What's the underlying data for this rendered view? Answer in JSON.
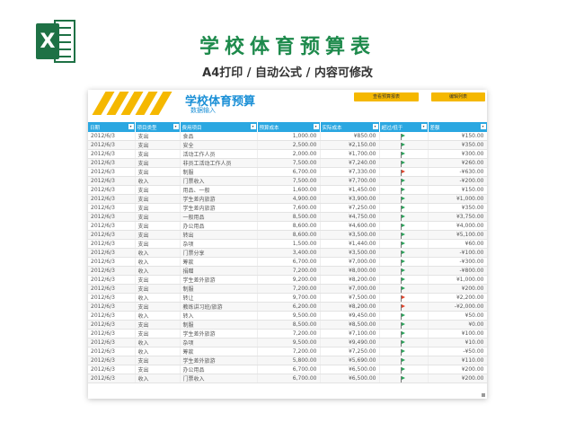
{
  "banner": {
    "title": "学校体育预算表",
    "subtitle": "A4打印 / 自动公式 / 内容可修改",
    "logo_icon": "excel-logo-icon",
    "logo_letter": "X"
  },
  "sheet": {
    "title": "学校体育预算",
    "subtitle": "数据输入",
    "buttons": [
      "查看预算报表",
      "编辑列表"
    ],
    "columns": [
      "日期",
      "项目类型",
      "费用项目",
      "预算成本",
      "实际成本",
      "超过/低于",
      "差额"
    ],
    "rows": [
      [
        "2012/6/3",
        "支出",
        "食品",
        "1,000.00",
        "¥850.00",
        "green",
        "¥150.00"
      ],
      [
        "2012/6/3",
        "支出",
        "安全",
        "2,500.00",
        "¥2,150.00",
        "green",
        "¥350.00"
      ],
      [
        "2012/6/3",
        "支出",
        "活动工作人员",
        "2,000.00",
        "¥1,700.00",
        "green",
        "¥300.00"
      ],
      [
        "2012/6/3",
        "支出",
        "非员工活动工作人员",
        "7,500.00",
        "¥7,240.00",
        "green",
        "¥260.00"
      ],
      [
        "2012/6/3",
        "支出",
        "制服",
        "6,700.00",
        "¥7,330.00",
        "red",
        "-¥630.00"
      ],
      [
        "2012/6/3",
        "收入",
        "门票收入",
        "7,500.00",
        "¥7,700.00",
        "green",
        "-¥200.00"
      ],
      [
        "2012/6/3",
        "支出",
        "用品、一般",
        "1,600.00",
        "¥1,450.00",
        "green",
        "¥150.00"
      ],
      [
        "2012/6/3",
        "支出",
        "学生差内旅游",
        "4,900.00",
        "¥3,900.00",
        "green",
        "¥1,000.00"
      ],
      [
        "2012/6/3",
        "支出",
        "学生差内旅游",
        "7,600.00",
        "¥7,250.00",
        "green",
        "¥350.00"
      ],
      [
        "2012/6/3",
        "支出",
        "一般用品",
        "8,500.00",
        "¥4,750.00",
        "green",
        "¥3,750.00"
      ],
      [
        "2012/6/3",
        "支出",
        "办公用品",
        "8,600.00",
        "¥4,600.00",
        "green",
        "¥4,000.00"
      ],
      [
        "2012/6/3",
        "支出",
        "转出",
        "8,600.00",
        "¥3,500.00",
        "green",
        "¥5,100.00"
      ],
      [
        "2012/6/3",
        "支出",
        "杂项",
        "1,500.00",
        "¥1,440.00",
        "green",
        "¥60.00"
      ],
      [
        "2012/6/3",
        "收入",
        "门票分享",
        "3,400.00",
        "¥3,500.00",
        "green",
        "-¥100.00"
      ],
      [
        "2012/6/3",
        "收入",
        "筹款",
        "6,700.00",
        "¥7,000.00",
        "green",
        "-¥300.00"
      ],
      [
        "2012/6/3",
        "收入",
        "捐赠",
        "7,200.00",
        "¥8,000.00",
        "green",
        "-¥800.00"
      ],
      [
        "2012/6/3",
        "支出",
        "学生差外旅游",
        "9,200.00",
        "¥8,200.00",
        "green",
        "¥1,000.00"
      ],
      [
        "2012/6/3",
        "支出",
        "制服",
        "7,200.00",
        "¥7,000.00",
        "green",
        "¥200.00"
      ],
      [
        "2012/6/3",
        "收入",
        "转让",
        "9,700.00",
        "¥7,500.00",
        "red",
        "¥2,200.00"
      ],
      [
        "2012/6/3",
        "支出",
        "教练讲习班/旅游",
        "6,200.00",
        "¥8,200.00",
        "red",
        "-¥2,000.00"
      ],
      [
        "2012/6/3",
        "收入",
        "转入",
        "9,500.00",
        "¥9,450.00",
        "green",
        "¥50.00"
      ],
      [
        "2012/6/3",
        "支出",
        "制服",
        "8,500.00",
        "¥8,500.00",
        "green",
        "¥0.00"
      ],
      [
        "2012/6/3",
        "支出",
        "学生差外旅游",
        "7,200.00",
        "¥7,100.00",
        "green",
        "¥100.00"
      ],
      [
        "2012/6/3",
        "收入",
        "杂项",
        "9,500.00",
        "¥9,490.00",
        "green",
        "¥10.00"
      ],
      [
        "2012/6/3",
        "收入",
        "筹款",
        "7,200.00",
        "¥7,250.00",
        "green",
        "-¥50.00"
      ],
      [
        "2012/6/3",
        "支出",
        "学生差外旅游",
        "5,800.00",
        "¥5,690.00",
        "green",
        "¥110.00"
      ],
      [
        "2012/6/3",
        "支出",
        "办公用品",
        "6,700.00",
        "¥6,500.00",
        "green",
        "¥200.00"
      ],
      [
        "2012/6/3",
        "收入",
        "门票收入",
        "6,700.00",
        "¥6,500.00",
        "green",
        "¥200.00"
      ]
    ],
    "accent_color": "#2aa7e1",
    "highlight_color": "#f5b800"
  }
}
